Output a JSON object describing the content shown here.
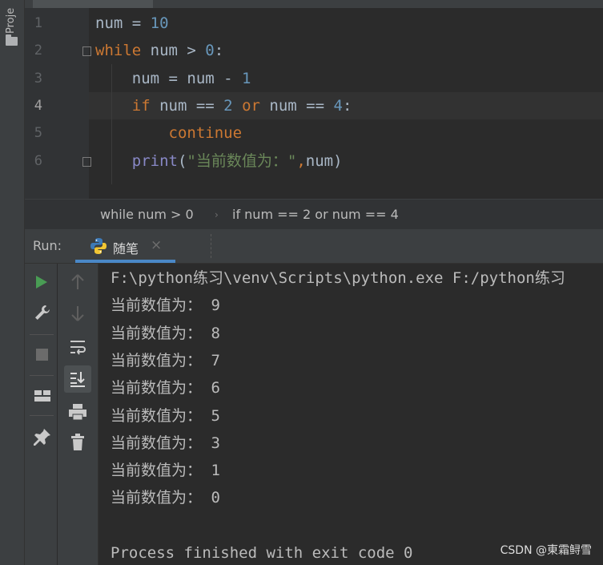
{
  "project_strip": {
    "label": "Proje",
    "icon": "folder-icon"
  },
  "editor": {
    "line_numbers": [
      "1",
      "2",
      "3",
      "4",
      "5",
      "6"
    ],
    "current_line": "4",
    "lines": [
      [
        {
          "t": "num = ",
          "c": "plain"
        },
        {
          "t": "10",
          "c": "num"
        }
      ],
      [
        {
          "t": "while",
          "c": "kw"
        },
        {
          "t": " num > ",
          "c": "plain"
        },
        {
          "t": "0",
          "c": "num"
        },
        {
          "t": ":",
          "c": "plain"
        }
      ],
      [
        {
          "t": "    num = num - ",
          "c": "plain"
        },
        {
          "t": "1",
          "c": "num"
        }
      ],
      [
        {
          "t": "    ",
          "c": "plain"
        },
        {
          "t": "if",
          "c": "kw"
        },
        {
          "t": " num == ",
          "c": "plain"
        },
        {
          "t": "2",
          "c": "num"
        },
        {
          "t": " ",
          "c": "plain"
        },
        {
          "t": "or",
          "c": "kw"
        },
        {
          "t": " num == ",
          "c": "plain"
        },
        {
          "t": "4",
          "c": "num"
        },
        {
          "t": ":",
          "c": "plain"
        }
      ],
      [
        {
          "t": "        ",
          "c": "plain"
        },
        {
          "t": "continue",
          "c": "kw"
        }
      ],
      [
        {
          "t": "    ",
          "c": "plain"
        },
        {
          "t": "print",
          "c": "fn"
        },
        {
          "t": "(",
          "c": "plain"
        },
        {
          "t": "\"当前数值为：\"",
          "c": "str"
        },
        {
          "t": ",",
          "c": "kw"
        },
        {
          "t": "num)",
          "c": "plain"
        }
      ]
    ]
  },
  "breadcrumbs": {
    "item1": "while num > 0",
    "item2": "if num == 2 or num == 4"
  },
  "run_panel": {
    "label": "Run:",
    "tab_title": "随笔",
    "tab_close": "×"
  },
  "console": {
    "lines": [
      "F:\\python练习\\venv\\Scripts\\python.exe F:/python练习",
      "当前数值为： 9",
      "当前数值为： 8",
      "当前数值为： 7",
      "当前数值为： 6",
      "当前数值为： 5",
      "当前数值为： 3",
      "当前数值为： 1",
      "当前数值为： 0",
      "",
      "Process finished with exit code 0"
    ]
  },
  "watermark": "CSDN @東霜鲟雪",
  "colors": {
    "keyword": "#cc7832",
    "number": "#6897bb",
    "string": "#6a8759",
    "builtin": "#8888c6",
    "run_accent": "#4a88c7",
    "run_green": "#499c54"
  }
}
